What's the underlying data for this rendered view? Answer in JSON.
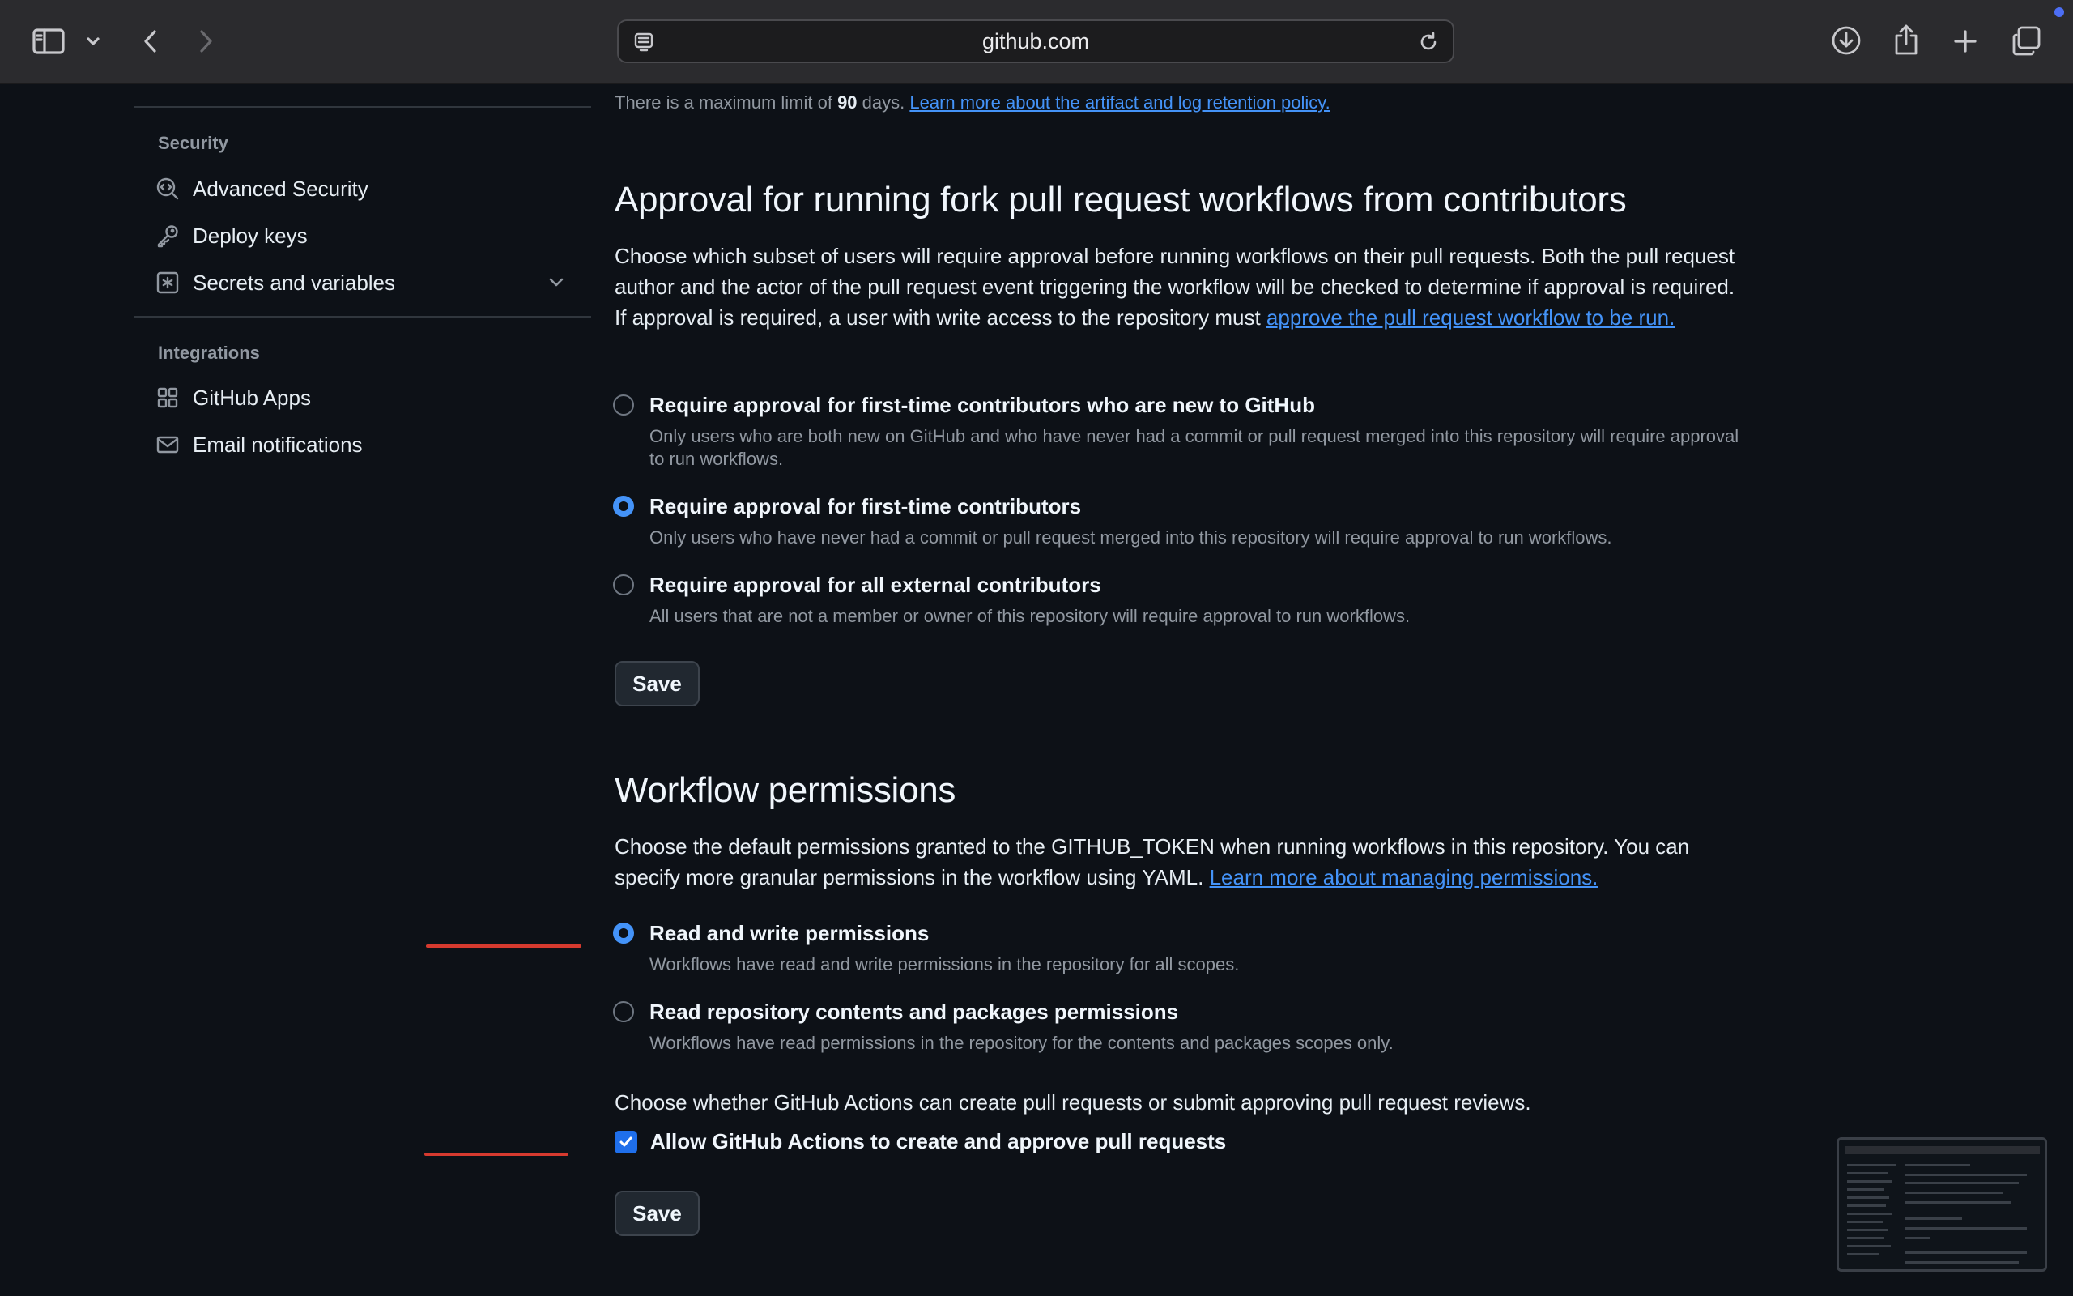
{
  "browser": {
    "url": "github.com"
  },
  "sidebar": {
    "security_heading": "Security",
    "security_items": [
      {
        "label": "Advanced Security",
        "icon": "codescan-icon"
      },
      {
        "label": "Deploy keys",
        "icon": "key-icon"
      },
      {
        "label": "Secrets and variables",
        "icon": "asterisk-icon"
      }
    ],
    "integrations_heading": "Integrations",
    "integration_items": [
      {
        "label": "GitHub Apps",
        "icon": "apps-icon"
      },
      {
        "label": "Email notifications",
        "icon": "mail-icon"
      }
    ]
  },
  "retention_note": {
    "prefix": "There is a maximum limit of ",
    "days": "90",
    "suffix": " days. ",
    "link": "Learn more about the artifact and log retention policy."
  },
  "fork_approval": {
    "heading": "Approval for running fork pull request workflows from contributors",
    "description": "Choose which subset of users will require approval before running workflows on their pull requests. Both the pull request author and the actor of the pull request event triggering the workflow will be checked to determine if approval is required. If approval is required, a user with write access to the repository must ",
    "description_link": "approve the pull request workflow to be run.",
    "options": [
      {
        "title": "Require approval for first-time contributors who are new to GitHub",
        "description": "Only users who are both new on GitHub and who have never had a commit or pull request merged into this repository will require approval to run workflows.",
        "selected": false
      },
      {
        "title": "Require approval for first-time contributors",
        "description": "Only users who have never had a commit or pull request merged into this repository will require approval to run workflows.",
        "selected": true
      },
      {
        "title": "Require approval for all external contributors",
        "description": "All users that are not a member or owner of this repository will require approval to run workflows.",
        "selected": false
      }
    ],
    "save_label": "Save"
  },
  "workflow_permissions": {
    "heading": "Workflow permissions",
    "description": "Choose the default permissions granted to the GITHUB_TOKEN when running workflows in this repository. You can specify more granular permissions in the workflow using YAML. ",
    "description_link": "Learn more about managing permissions.",
    "options": [
      {
        "title": "Read and write permissions",
        "description": "Workflows have read and write permissions in the repository for all scopes.",
        "selected": true
      },
      {
        "title": "Read repository contents and packages permissions",
        "description": "Workflows have read permissions in the repository for the contents and packages scopes only.",
        "selected": false
      }
    ],
    "pr_prompt": "Choose whether GitHub Actions can create pull requests or submit approving pull request reviews.",
    "pr_checkbox_label": "Allow GitHub Actions to create and approve pull requests",
    "pr_checkbox_checked": true,
    "save_label": "Save"
  },
  "colors": {
    "accent": "#4493f8",
    "annotation_red": "#d63a2f",
    "background": "#0d1117"
  }
}
